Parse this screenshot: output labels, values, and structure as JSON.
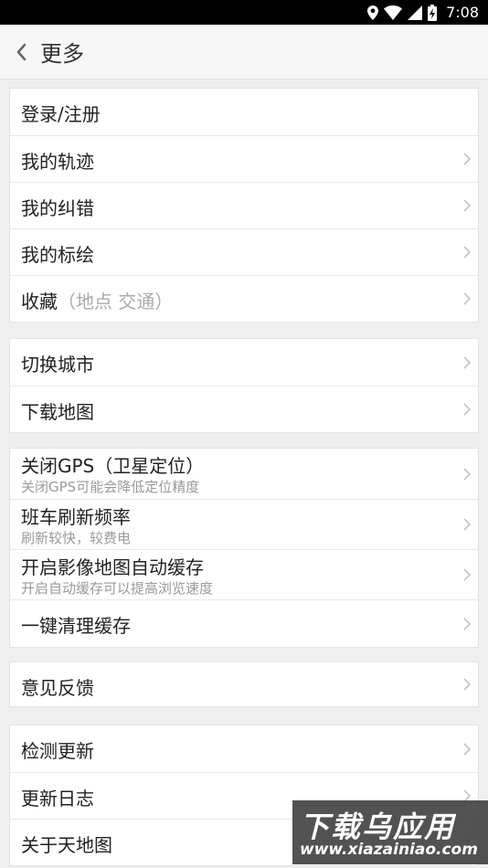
{
  "status_bar": {
    "time": "7:08"
  },
  "header": {
    "title": "更多"
  },
  "groups": [
    {
      "items": [
        {
          "label": "登录/注册",
          "has_arrow": false
        },
        {
          "label": "我的轨迹",
          "has_arrow": true
        },
        {
          "label": "我的纠错",
          "has_arrow": true
        },
        {
          "label": "我的标绘",
          "has_arrow": true
        },
        {
          "label": "收藏",
          "hint": "（地点 交通）",
          "has_arrow": true
        }
      ]
    },
    {
      "items": [
        {
          "label": "切换城市",
          "has_arrow": true
        },
        {
          "label": "下载地图",
          "has_arrow": true
        }
      ]
    },
    {
      "items": [
        {
          "label": "关闭GPS（卫星定位）",
          "sub": "关闭GPS可能会降低定位精度",
          "has_arrow": true
        },
        {
          "label": "班车刷新频率",
          "sub": "刷新较快，较费电",
          "has_arrow": true
        },
        {
          "label": "开启影像地图自动缓存",
          "sub": "开启自动缓存可以提高浏览速度",
          "has_arrow": true
        },
        {
          "label": "一键清理缓存",
          "has_arrow": true
        }
      ]
    },
    {
      "items": [
        {
          "label": "意见反馈",
          "has_arrow": true
        }
      ]
    },
    {
      "items": [
        {
          "label": "检测更新",
          "has_arrow": true
        },
        {
          "label": "更新日志",
          "has_arrow": true
        },
        {
          "label": "关于天地图",
          "has_arrow": true
        }
      ]
    }
  ],
  "watermark": {
    "title": "下载乌应用",
    "url": "www.xiazainiao.com"
  },
  "colors": {
    "background": "#efefef",
    "text": "#222222",
    "subtext": "#9a9a9a",
    "chevron": "#c4c4c4"
  }
}
